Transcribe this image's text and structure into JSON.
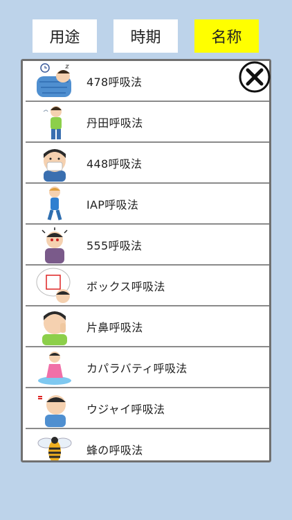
{
  "tabs": [
    {
      "label": "用途"
    },
    {
      "label": "時期"
    },
    {
      "label": "名称"
    }
  ],
  "colors": {
    "background": "#bdd3ea",
    "active_tab": "#ffff00",
    "tab": "#ffffff",
    "panel_border": "#707070"
  },
  "items": [
    {
      "label": "478呼吸法",
      "icon": "sleeping-person-icon"
    },
    {
      "label": "丹田呼吸法",
      "icon": "breathing-person-icon"
    },
    {
      "label": "448呼吸法",
      "icon": "masked-person-icon"
    },
    {
      "label": "IAP呼吸法",
      "icon": "running-person-icon"
    },
    {
      "label": "555呼吸法",
      "icon": "stressed-person-icon"
    },
    {
      "label": "ボックス呼吸法",
      "icon": "thinking-box-icon"
    },
    {
      "label": "片鼻呼吸法",
      "icon": "nostril-breathing-icon"
    },
    {
      "label": "カパラバティ呼吸法",
      "icon": "meditating-person-icon"
    },
    {
      "label": "ウジャイ呼吸法",
      "icon": "ujjayi-breath-icon"
    },
    {
      "label": "蜂の呼吸法",
      "icon": "bee-icon"
    }
  ],
  "close_icon": "close-x-icon",
  "active_tab": "名称"
}
